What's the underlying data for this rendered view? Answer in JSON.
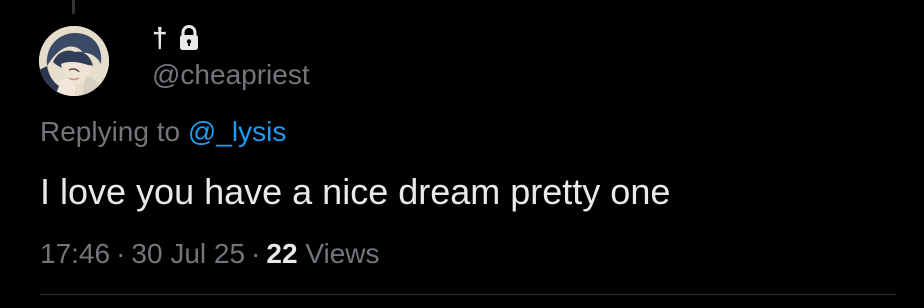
{
  "author": {
    "display_name": "†",
    "handle": "@cheapriest",
    "avatar_icon": "avatar-image",
    "protected_icon": "lock-icon"
  },
  "reply": {
    "prefix": "Replying to",
    "mention": "@_lysis"
  },
  "tweet": {
    "text": "I love you have a nice dream pretty one"
  },
  "meta": {
    "time": "17:46",
    "separator": "·",
    "date": "30 Jul 25",
    "views_count": "22",
    "views_label": "Views"
  },
  "colors": {
    "background": "#000000",
    "text_primary": "#e7e9ea",
    "text_secondary": "#71767b",
    "link": "#1d9bf0",
    "divider": "#2f3336"
  }
}
